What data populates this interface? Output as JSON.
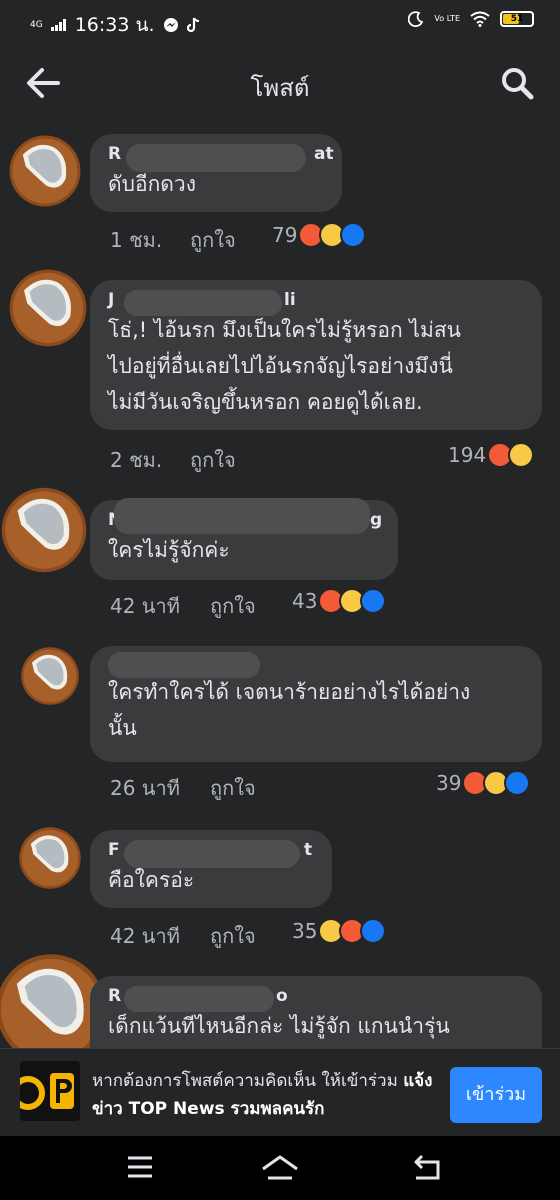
{
  "status_bar": {
    "network": "4G",
    "time": "16:33 น.",
    "volte": "Vo LTE",
    "battery": "51"
  },
  "header": {
    "title": "โพสต์"
  },
  "comments": [
    {
      "name_visible": "R",
      "name_end": "at",
      "text": "ดับอีกดวง",
      "time": "1 ชม.",
      "like": "ถูกใจ",
      "reactions_count": "79"
    },
    {
      "name_visible": "J",
      "name_end": "li",
      "text": "โธ่,! ไอ้นรก มึงเป็นใครไม่รู้หรอก ไม่สน\nไปอยู่ที่อื่นเลยไปไอ้นรกจัญไรอย่างมึงนี่\nไม่มีวันเจริญขึ้นหรอก คอยดูได้เลย.",
      "time": "2 ชม.",
      "like": "ถูกใจ",
      "reactions_count": "194"
    },
    {
      "name_visible": "N",
      "name_end": "g",
      "text": "ใครไม่รู้จักค่ะ",
      "time": "42 นาที",
      "like": "ถูกใจ",
      "reactions_count": "43"
    },
    {
      "name_visible": "",
      "name_end": "",
      "text": "ใครทำใครได้ เจตนาร้ายอย่างไรได้อย่าง\nนั้น",
      "time": "26 นาที",
      "like": "ถูกใจ",
      "reactions_count": "39"
    },
    {
      "name_visible": "F",
      "name_end": "t",
      "text": "คือใครอ่ะ",
      "time": "42 นาที",
      "like": "ถูกใจ",
      "reactions_count": "35"
    },
    {
      "name_visible": "R",
      "name_end": "o",
      "text": "เด็กแว้นทีไหนอีกล่ะ ไม่รู้จัก แกนนำรุ่น",
      "time": "",
      "like": "",
      "reactions_count": ""
    }
  ],
  "banner": {
    "message_prefix": "หากต้องการโพสต์ความคิดเห็น ให้เข้าร่วม ",
    "group_name": "แจ้งข่าว TOP News รวมพลคนรัก",
    "join_label": "เข้าร่วม"
  },
  "colors": {
    "background": "#242526",
    "bubble": "#3a3b3c",
    "accent": "#2d88ff",
    "angry": "#f25a38",
    "wow": "#f7c944",
    "like": "#1877f2"
  },
  "icons": [
    "back-arrow-icon",
    "search-icon",
    "angry-reaction-icon",
    "wow-reaction-icon",
    "like-reaction-icon",
    "recents-icon",
    "home-icon",
    "back-icon"
  ]
}
